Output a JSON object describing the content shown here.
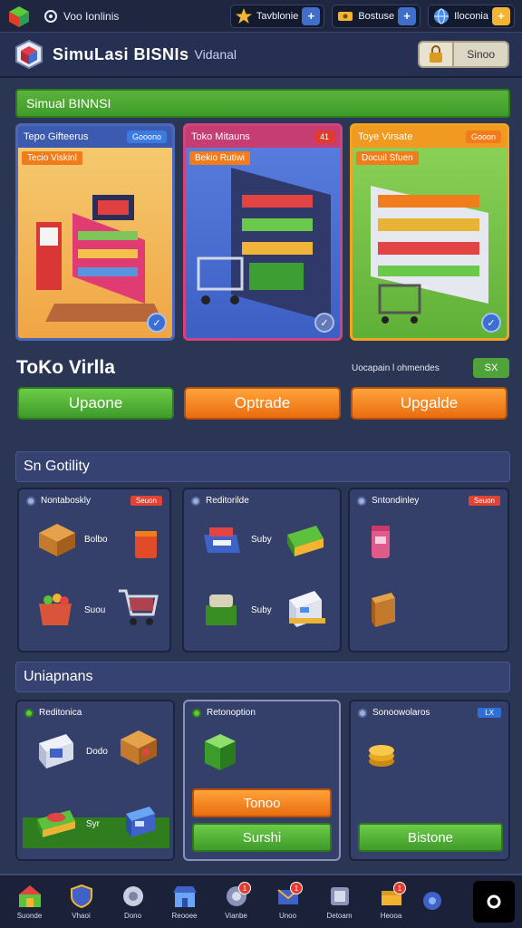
{
  "topbar": {
    "account_label": "Voo Ionlinis",
    "resources": [
      {
        "icon": "star-icon",
        "label": "Tavblonie"
      },
      {
        "icon": "ticket-icon",
        "label": "Bostuse"
      },
      {
        "icon": "globe-icon",
        "label": "Iloconia"
      }
    ]
  },
  "titlebar": {
    "title": "SimuLasi BISNIs",
    "subtitle": "Vidanal",
    "button_label": "Sinoo"
  },
  "banner": {
    "label": "Simual BINNSI"
  },
  "cards": [
    {
      "title": "Tepo Gifteerus",
      "tag": "Gooono",
      "sub": "Tecio Viskinl",
      "color": "#4a67b8"
    },
    {
      "title": "Toko Mitauns",
      "tag": "41",
      "sub": "Bekio Rutiwi",
      "color": "#d3447c"
    },
    {
      "title": "Toye Virsate",
      "tag": "Gooon",
      "sub": "Docuil Sfuen",
      "color": "#f2a31f"
    }
  ],
  "shop": {
    "title": "ToKo Virlla",
    "note": "Uocapain l ohmendes",
    "pill": "SX"
  },
  "upgrade_buttons": [
    "Upaone",
    "Optrade",
    "Upgalde"
  ],
  "section_one": {
    "label": "Sn Gotility"
  },
  "panels_top": [
    {
      "title": "Nontaboskly",
      "tag": "Seuon",
      "items": [
        {
          "label": "Bolbo"
        },
        {
          "label": "Suou"
        }
      ]
    },
    {
      "title": "Reditorilde",
      "tag": "",
      "items": [
        {
          "label": "Suby"
        },
        {
          "label": "Suby"
        }
      ]
    },
    {
      "title": "Sntondinley",
      "tag": "Seuon",
      "items": []
    }
  ],
  "section_two": {
    "label": "Uniapnans"
  },
  "panels_bottom": [
    {
      "title": "Reditonica",
      "tag": "",
      "items": [
        {
          "label": "Dodo"
        },
        {
          "label": "Syr"
        }
      ]
    },
    {
      "title": "Retonoption",
      "tag": "",
      "buttons": [
        "Tonoo",
        "Surshi"
      ]
    },
    {
      "title": "Sonoowolaros",
      "tag": "LX",
      "buttons": [
        "Bistone"
      ]
    }
  ],
  "nav": [
    {
      "icon": "home-icon",
      "label": "Suonde",
      "badge": ""
    },
    {
      "icon": "shield-icon",
      "label": "Vhaoi",
      "badge": ""
    },
    {
      "icon": "gear-icon",
      "label": "Dono",
      "badge": ""
    },
    {
      "icon": "store-icon",
      "label": "Reooee",
      "badge": ""
    },
    {
      "icon": "map-icon",
      "label": "Vianbe",
      "badge": "1"
    },
    {
      "icon": "mail-icon",
      "label": "Unoo",
      "badge": "1"
    },
    {
      "icon": "trophy-icon",
      "label": "Detoam",
      "badge": ""
    },
    {
      "icon": "box-icon",
      "label": "Heooa",
      "badge": "1"
    },
    {
      "icon": "help-icon",
      "label": "",
      "badge": ""
    }
  ]
}
